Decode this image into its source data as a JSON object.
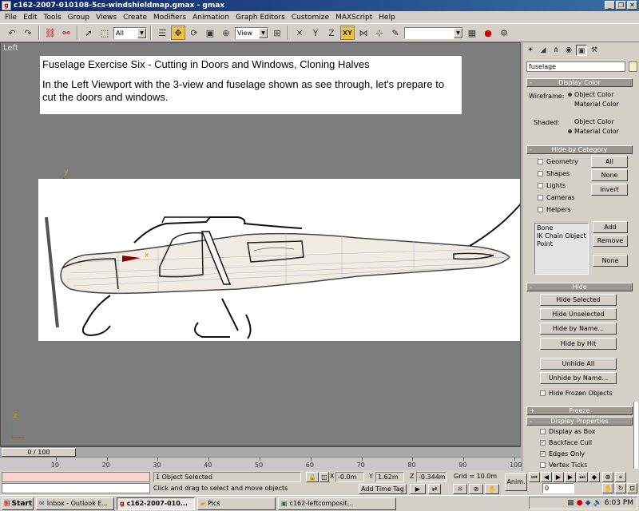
{
  "window": {
    "title": "c162-2007-010108-5cs-windshieldmap.gmax - gmax",
    "controls": [
      "_",
      "❐",
      "✕"
    ]
  },
  "menus": [
    {
      "label": "File",
      "ul": "F",
      "rest": "ile"
    },
    {
      "label": "Edit",
      "ul": "E",
      "rest": "dit"
    },
    {
      "label": "Tools",
      "ul": "T",
      "rest": "ools"
    },
    {
      "label": "Group",
      "ul": "G",
      "rest": "roup"
    },
    {
      "label": "Views",
      "ul": "V",
      "rest": "iews"
    },
    {
      "label": "Create",
      "ul": "C",
      "rest": "reate"
    },
    {
      "label": "Modifiers",
      "ul": "o",
      "pre": "M",
      "rest": "difiers"
    },
    {
      "label": "Animation",
      "ul": "A",
      "rest": "nimation"
    },
    {
      "label": "Graph Editors",
      "ul": "G",
      "rest": "raph Editors"
    },
    {
      "label": "Customize",
      "ul": "C",
      "rest": "ustomize"
    },
    {
      "label": "MAXScript",
      "ul": "M",
      "rest": "AXScript"
    },
    {
      "label": "Help",
      "ul": "H",
      "rest": "elp"
    }
  ],
  "toolbar": {
    "selection_filter": "All",
    "ref_coord": "View",
    "axis_constraint": "XY",
    "named_selection": ""
  },
  "viewport": {
    "label": "Left",
    "info_title": "Fuselage Exercise Six - Cutting in Doors and Windows, Cloning Halves",
    "info_body": "In the Left Viewport with the 3-view and fuselage shown as see through, let's prepare to cut the doors and windows.",
    "axis_y": "y",
    "axis_x": "x",
    "axis_z": "z"
  },
  "timeline": {
    "slider_label": "0 / 100",
    "ticks": [
      "10",
      "20",
      "30",
      "40",
      "50",
      "60",
      "70",
      "80",
      "90",
      "100"
    ]
  },
  "status": {
    "selection": "1 Object Selected",
    "prompt": "Click and drag to select and move objects",
    "x_label": "X",
    "x_value": "-0.0m",
    "y_label": "Y",
    "y_value": "1.62m",
    "z_label": "Z",
    "z_value": "-0.344m",
    "grid": "Grid = 10.0m",
    "add_time_tag": "Add Time Tag",
    "anim": "Anim.",
    "frame": "0"
  },
  "command_panel": {
    "object_name": "fuselage",
    "object_color": "#f8f0c0",
    "display_color": {
      "title": "Display Color",
      "wireframe_label": "Wireframe:",
      "shaded_label": "Shaded:",
      "object_color": "Object Color",
      "material_color": "Material Color"
    },
    "hide_by_category": {
      "title": "Hide by Category",
      "items": [
        "Geometry",
        "Shapes",
        "Lights",
        "Cameras",
        "Helpers"
      ],
      "buttons": [
        "All",
        "None",
        "Invert"
      ],
      "list": [
        "Bone",
        "IK Chain Object",
        "Point"
      ],
      "list_buttons": [
        "Add",
        "Remove",
        "None"
      ]
    },
    "hide": {
      "title": "Hide",
      "buttons": [
        "Hide Selected",
        "Hide Unselected",
        "Hide by Name...",
        "Hide by Hit",
        "Unhide All",
        "Unhide by Name..."
      ],
      "frozen": "Hide Frozen Objects"
    },
    "freeze": {
      "title": "Freeze"
    },
    "display_properties": {
      "title": "Display Properties",
      "items": [
        "Display as Box",
        "Backface Cull",
        "Edges Only",
        "Vertex Ticks"
      ],
      "checked": [
        false,
        true,
        true,
        false
      ]
    }
  },
  "taskbar": {
    "start": "Start",
    "tasks": [
      "Inbox - Outlook E...",
      "c162-2007-010...",
      "Pics",
      "c162-leftcomposit..."
    ],
    "clock": "6:03 PM"
  }
}
